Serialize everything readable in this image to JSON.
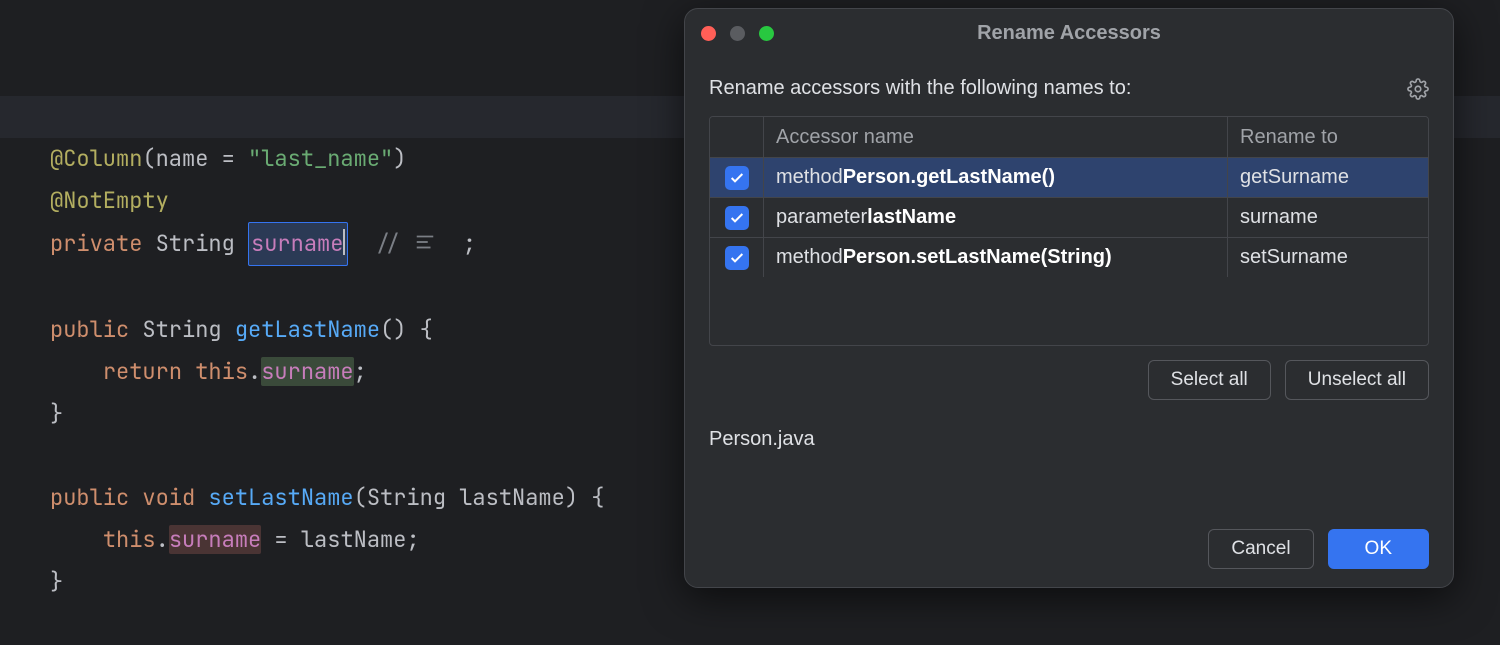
{
  "editor": {
    "annotation_column": "@Column",
    "annotation_column_arg_key": "name",
    "annotation_column_arg_val": "\"last_name\"",
    "annotation_notempty": "@NotEmpty",
    "kw_private": "private",
    "kw_public": "public",
    "kw_void": "void",
    "kw_return": "return",
    "kw_this": "this",
    "type_string": "String",
    "field_name": "surname",
    "getter_name": "getLastName",
    "setter_name": "setLastName",
    "setter_param": "lastName",
    "comment_marker": "//",
    "semicolon": ";"
  },
  "dialog": {
    "title": "Rename Accessors",
    "prompt": "Rename accessors with the following names to:",
    "cols": {
      "name": "Accessor name",
      "to": "Rename to"
    },
    "rows": [
      {
        "kind": "method",
        "bold": "Person.getLastName()",
        "to": "getSurname",
        "checked": true,
        "selected": true
      },
      {
        "kind": "parameter",
        "bold": "lastName",
        "to": "surname",
        "checked": true,
        "selected": false
      },
      {
        "kind": "method",
        "bold": "Person.setLastName(String)",
        "to": "setSurname",
        "checked": true,
        "selected": false
      }
    ],
    "select_all": "Select all",
    "unselect_all": "Unselect all",
    "file": "Person.java",
    "cancel": "Cancel",
    "ok": "OK"
  }
}
